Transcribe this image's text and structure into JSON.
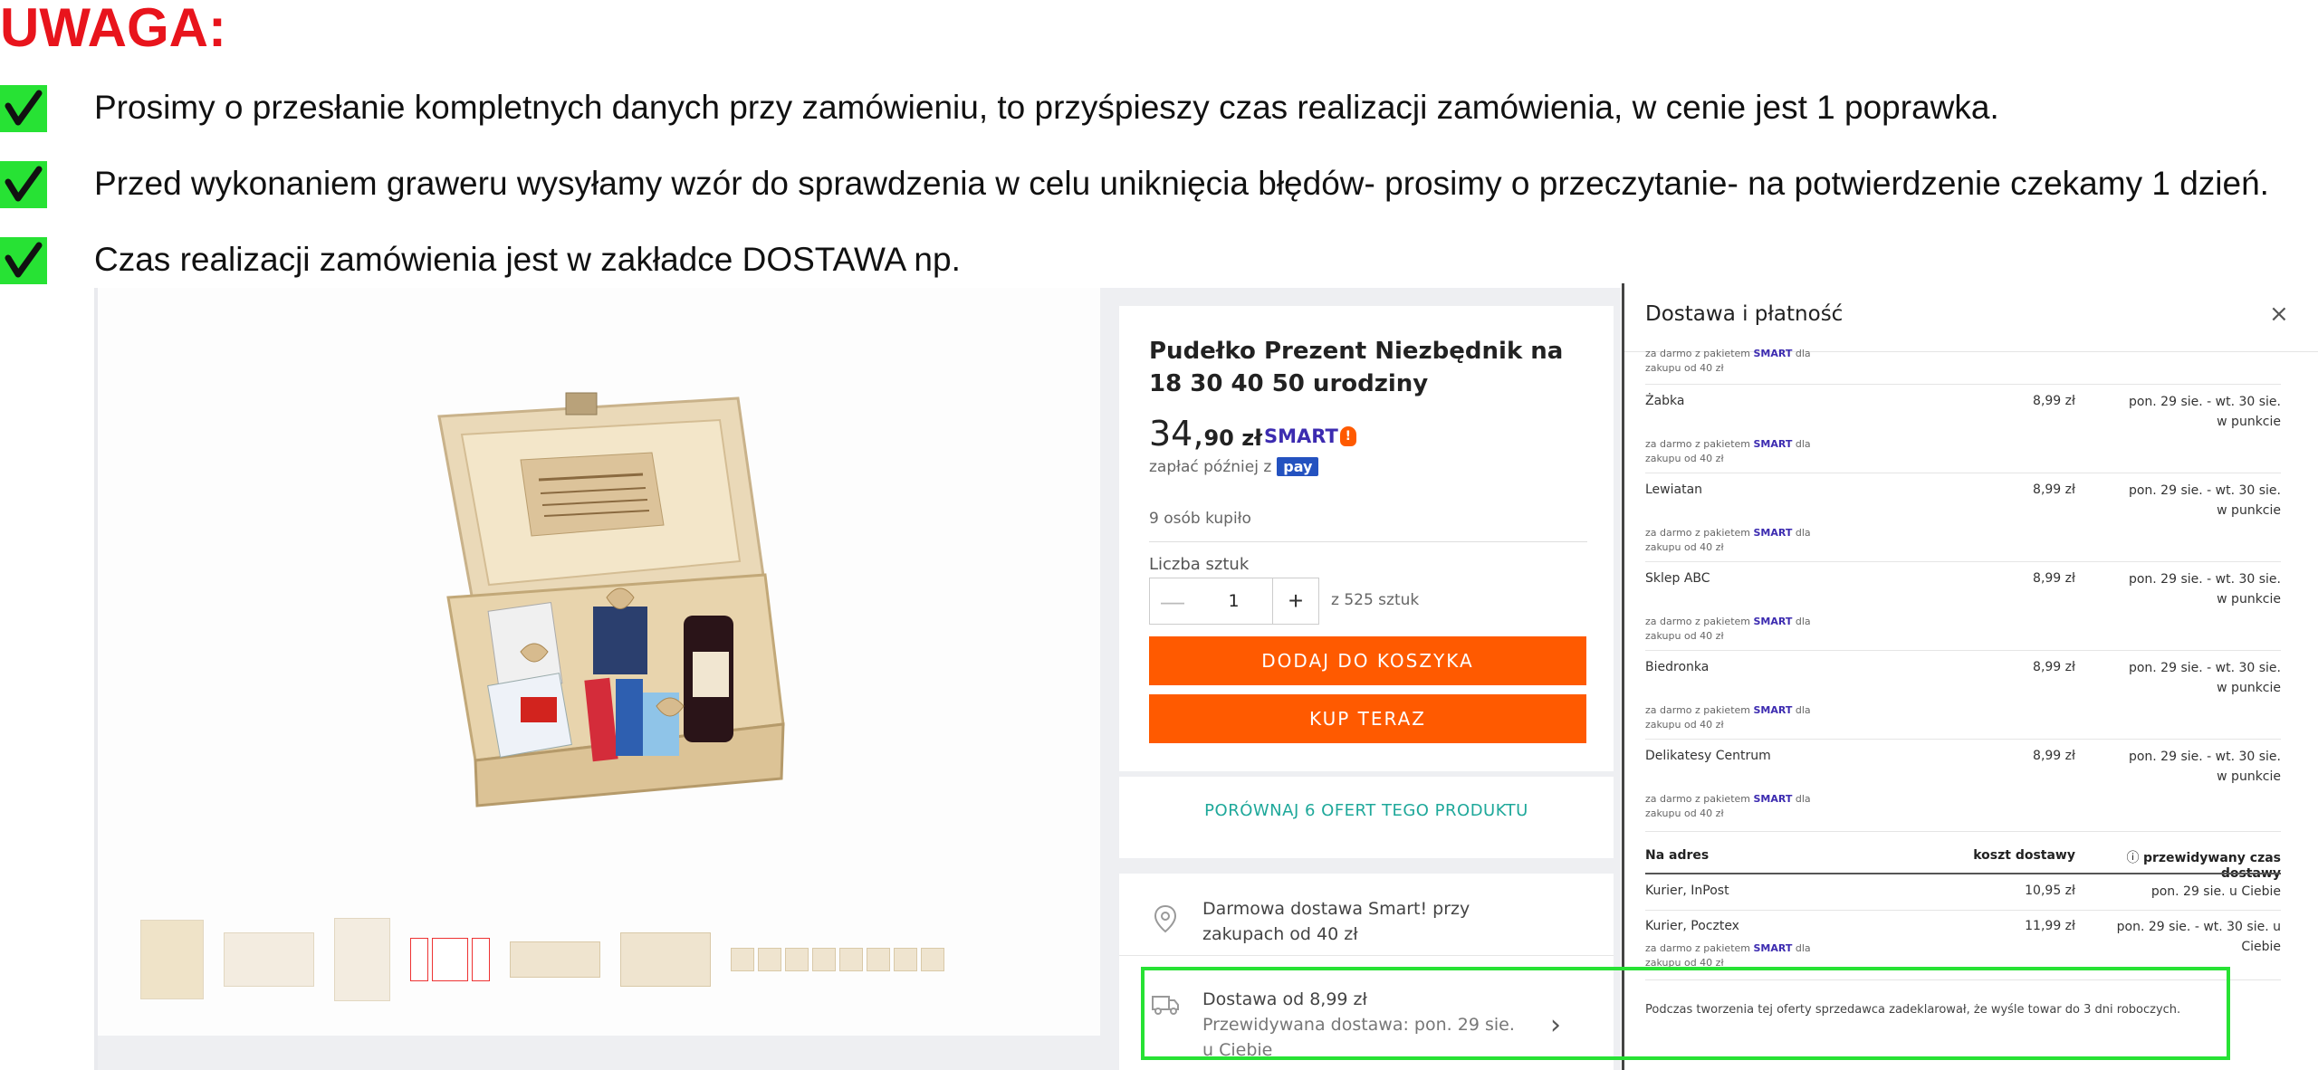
{
  "notice": {
    "heading": "UWAGA:",
    "items": [
      "Prosimy o przesłanie kompletnych danych przy zamówieniu, to przyśpieszy czas realizacji zamówienia, w cenie jest 1 poprawka.",
      "Przed wykonaniem graweru wysyłamy wzór do sprawdzenia w celu uniknięcia błędów- prosimy o przeczytanie- na potwierdzenie czekamy 1 dzień.",
      "Czas realizacji zamówienia jest w zakładce DOSTAWA np."
    ],
    "check_color": "#27e234",
    "heading_color": "#e8141c"
  },
  "product": {
    "title": "Pudełko Prezent Niezbędnik na 18 30 40 50 urodziny",
    "price_main": "34,",
    "price_rest": "90 zł",
    "smart_label": "SMART",
    "pay_later_text": "zapłać później z",
    "pay_badge": "pay",
    "bought": "9 osób kupiło",
    "qty_label": "Liczba sztuk",
    "qty_value": "1",
    "qty_of": "z 525 sztuk",
    "add_to_cart": "DODAJ DO KOSZYKA",
    "buy_now": "KUP TERAZ",
    "compare": "PORÓWNAJ 6 OFERT TEGO PRODUKTU",
    "free_delivery_line1": "Darmowa dostawa Smart! przy",
    "free_delivery_line2": "zakupach od 40 zł",
    "delivery_from": "Dostawa od 8,99 zł",
    "delivery_expected_line1": "Przewidywana dostawa: pon. 29 sie.",
    "delivery_expected_line2": "u Ciebie",
    "accent_color": "#ff5a00"
  },
  "delivery_panel": {
    "title": "Dostawa i płatność",
    "close": "×",
    "top_note": {
      "prefix": "za darmo z pakietem",
      "smart": "SMART",
      "suffix": "dla",
      "line2": "zakupu od 40 zł"
    },
    "pickup_rows": [
      {
        "name": "Żabka",
        "price": "8,99 zł",
        "when1": "pon. 29 sie. - wt. 30 sie.",
        "when2": "w punkcie",
        "note_prefix": "za darmo z pakietem",
        "note_smart": "SMART",
        "note_suffix": "dla",
        "note_line2": "zakupu od 40 zł"
      },
      {
        "name": "Lewiatan",
        "price": "8,99 zł",
        "when1": "pon. 29 sie. - wt. 30 sie.",
        "when2": "w punkcie",
        "note_prefix": "za darmo z pakietem",
        "note_smart": "SMART",
        "note_suffix": "dla",
        "note_line2": "zakupu od 40 zł"
      },
      {
        "name": "Sklep ABC",
        "price": "8,99 zł",
        "when1": "pon. 29 sie. - wt. 30 sie.",
        "when2": "w punkcie",
        "note_prefix": "za darmo z pakietem",
        "note_smart": "SMART",
        "note_suffix": "dla",
        "note_line2": "zakupu od 40 zł"
      },
      {
        "name": "Biedronka",
        "price": "8,99 zł",
        "when1": "pon. 29 sie. - wt. 30 sie.",
        "when2": "w punkcie",
        "note_prefix": "za darmo z pakietem",
        "note_smart": "SMART",
        "note_suffix": "dla",
        "note_line2": "zakupu od 40 zł"
      },
      {
        "name": "Delikatesy Centrum",
        "price": "8,99 zł",
        "when1": "pon. 29 sie. - wt. 30 sie.",
        "when2": "w punkcie",
        "note_prefix": "za darmo z pakietem",
        "note_smart": "SMART",
        "note_suffix": "dla",
        "note_line2": "zakupu od 40 zł"
      }
    ],
    "address_section": {
      "header": "Na adres",
      "cost_header": "koszt dostawy",
      "time_header": "przewidywany czas dostawy",
      "rows": [
        {
          "name": "Kurier, InPost",
          "price": "10,95 zł",
          "when": "pon. 29 sie. u Ciebie"
        },
        {
          "name": "Kurier, Pocztex",
          "price": "11,99 zł",
          "when": "pon. 29 sie. - wt. 30 sie. u Ciebie"
        }
      ],
      "last_note_prefix": "za darmo z pakietem",
      "last_note_smart": "SMART",
      "last_note_suffix": "dla",
      "last_note_line2": "zakupu od 40 zł"
    },
    "footer_note": "Podczas tworzenia tej oferty sprzedawca zadeklarował, że wyśle towar do 3 dni roboczych."
  },
  "gallery": {
    "thumb_count_large": 4,
    "highlight_color": "#27e234"
  }
}
